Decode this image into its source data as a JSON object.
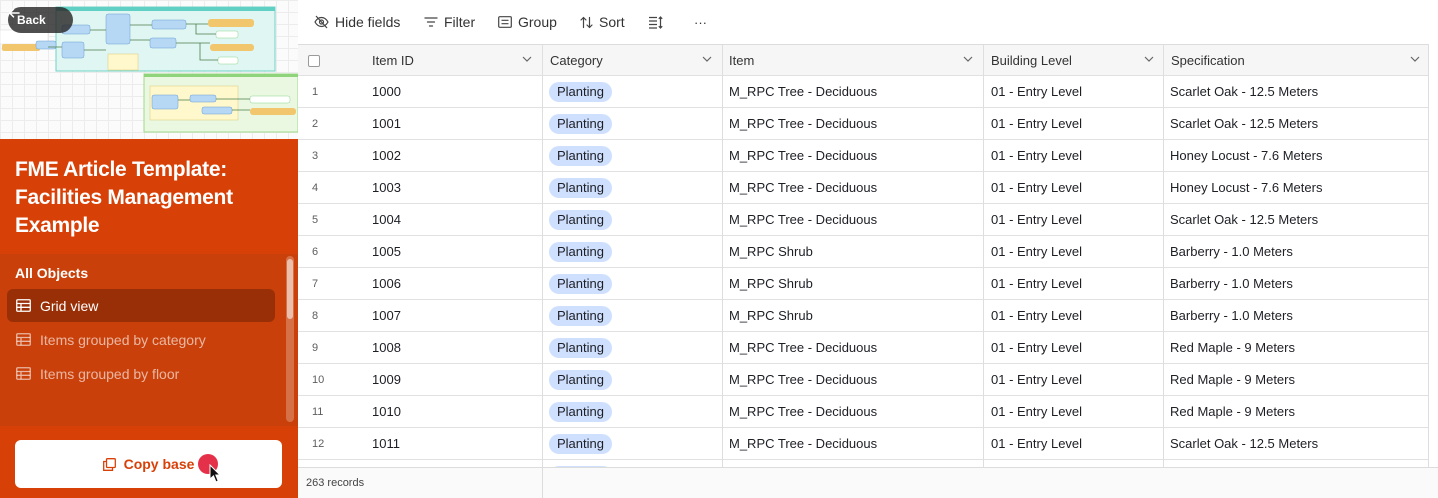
{
  "sidebar": {
    "back_label": "Back",
    "title": "FME Article Template: Facilities Management Example",
    "section_label": "All Objects",
    "views": [
      {
        "label": "Grid view",
        "active": true
      },
      {
        "label": "Items grouped by category",
        "active": false
      },
      {
        "label": "Items grouped by floor",
        "active": false
      }
    ],
    "copy_label": "Copy base"
  },
  "toolbar": {
    "hide_fields": "Hide fields",
    "filter": "Filter",
    "group": "Group",
    "sort": "Sort",
    "more": "···"
  },
  "table": {
    "columns": [
      "Item ID",
      "Category",
      "Item",
      "Building Level",
      "Specification"
    ],
    "rows": [
      {
        "n": "1",
        "id": "1000",
        "category": "Planting",
        "item": "M_RPC Tree - Deciduous",
        "level": "01 - Entry Level",
        "spec": "Scarlet Oak - 12.5 Meters"
      },
      {
        "n": "2",
        "id": "1001",
        "category": "Planting",
        "item": "M_RPC Tree - Deciduous",
        "level": "01 - Entry Level",
        "spec": "Scarlet Oak - 12.5 Meters"
      },
      {
        "n": "3",
        "id": "1002",
        "category": "Planting",
        "item": "M_RPC Tree - Deciduous",
        "level": "01 - Entry Level",
        "spec": "Honey Locust - 7.6 Meters"
      },
      {
        "n": "4",
        "id": "1003",
        "category": "Planting",
        "item": "M_RPC Tree - Deciduous",
        "level": "01 - Entry Level",
        "spec": "Honey Locust - 7.6 Meters"
      },
      {
        "n": "5",
        "id": "1004",
        "category": "Planting",
        "item": "M_RPC Tree - Deciduous",
        "level": "01 - Entry Level",
        "spec": "Scarlet Oak - 12.5 Meters"
      },
      {
        "n": "6",
        "id": "1005",
        "category": "Planting",
        "item": "M_RPC Shrub",
        "level": "01 - Entry Level",
        "spec": "Barberry - 1.0 Meters"
      },
      {
        "n": "7",
        "id": "1006",
        "category": "Planting",
        "item": "M_RPC Shrub",
        "level": "01 - Entry Level",
        "spec": "Barberry - 1.0 Meters"
      },
      {
        "n": "8",
        "id": "1007",
        "category": "Planting",
        "item": "M_RPC Shrub",
        "level": "01 - Entry Level",
        "spec": "Barberry - 1.0 Meters"
      },
      {
        "n": "9",
        "id": "1008",
        "category": "Planting",
        "item": "M_RPC Tree - Deciduous",
        "level": "01 - Entry Level",
        "spec": "Red Maple - 9 Meters"
      },
      {
        "n": "10",
        "id": "1009",
        "category": "Planting",
        "item": "M_RPC Tree - Deciduous",
        "level": "01 - Entry Level",
        "spec": "Red Maple - 9 Meters"
      },
      {
        "n": "11",
        "id": "1010",
        "category": "Planting",
        "item": "M_RPC Tree - Deciduous",
        "level": "01 - Entry Level",
        "spec": "Red Maple - 9 Meters"
      },
      {
        "n": "12",
        "id": "1011",
        "category": "Planting",
        "item": "M_RPC Tree - Deciduous",
        "level": "01 - Entry Level",
        "spec": "Scarlet Oak - 12.5 Meters"
      }
    ]
  },
  "footer": {
    "record_count": "263 records"
  },
  "colors": {
    "sidebar_bg": "#d74108",
    "nav_bg": "#c9400a",
    "active_item_bg": "#982f07",
    "pill_bg": "#cfe0ff",
    "cursor_dot": "#e5304a"
  },
  "icons": [
    "back-arrow-icon",
    "hide-fields-icon",
    "filter-icon",
    "group-icon",
    "sort-icon",
    "row-height-icon",
    "more-icon",
    "grid-view-icon",
    "copy-icon",
    "chevron-down-icon",
    "mouse-pointer-icon"
  ]
}
